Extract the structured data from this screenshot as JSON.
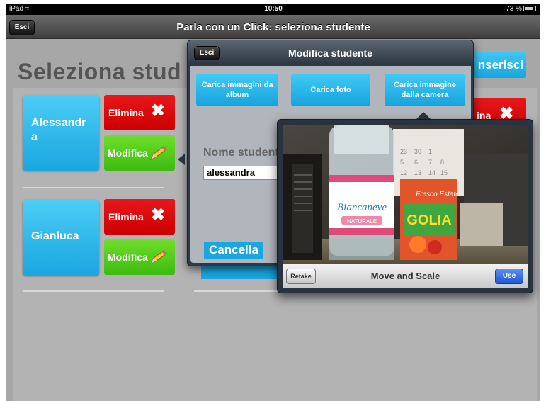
{
  "status_bar": {
    "device": "iPad",
    "wifi_icon": "wifi-icon",
    "time": "10:50",
    "battery": "73 %"
  },
  "nav_bar": {
    "back_label": "Esci",
    "title": "Parla con un Click: seleziona studente"
  },
  "page": {
    "title_partial": "Seleziona stud",
    "insert_label_partial": "nserisci",
    "students": [
      {
        "name": "Alessandr a",
        "delete_label": "Elimina",
        "edit_label": "Modifica"
      },
      {
        "name": "Gianluca",
        "delete_label": "Elimina",
        "edit_label": "Modifica"
      }
    ],
    "partial_delete_label": "ina"
  },
  "edit_popover": {
    "back_label": "Esci",
    "title": "Modifica studente",
    "buttons": [
      "Carica immagini da album",
      "Carica foto",
      "Carica immagine dalla camera"
    ],
    "name_label": "Nome student",
    "name_value": "alessandra",
    "cancel_label": "Cancella"
  },
  "camera_popover": {
    "retake_label": "Retake",
    "title": "Move and Scale",
    "use_label": "Use",
    "photo_texts": {
      "bottle_brand": "Biancaneve",
      "bottle_sub": "NATURALE",
      "box_brand": "GOLIA",
      "box_tag": "Fresco Estate"
    }
  },
  "colors": {
    "accent_blue": "#1aa6e0",
    "delete_red": "#e8171b",
    "edit_green": "#4cc61a",
    "nav_dark": "#3f3f3f",
    "ios_use_blue": "#1f57d3"
  }
}
